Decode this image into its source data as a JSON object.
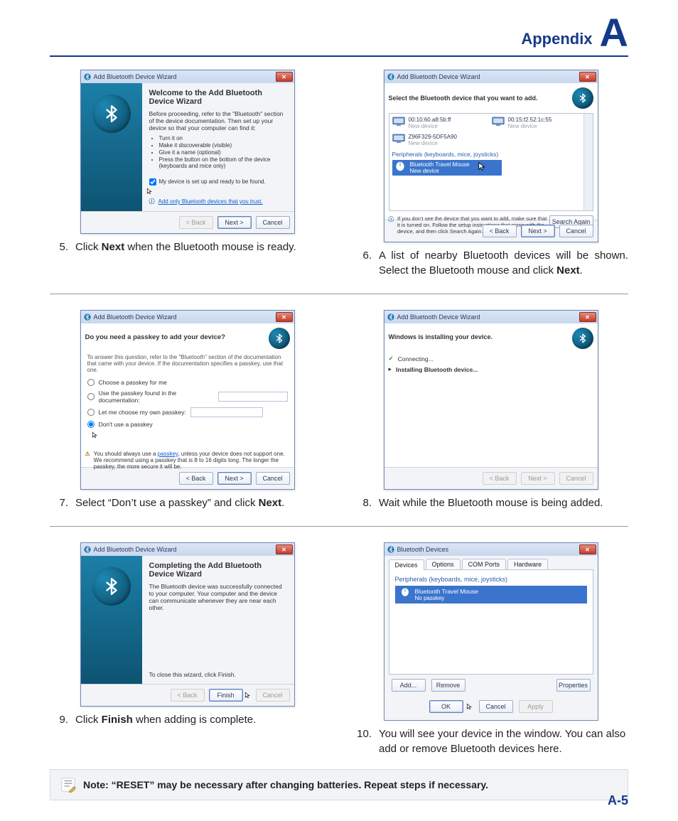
{
  "header": {
    "appendix": "Appendix",
    "bigA": "A"
  },
  "pageNumber": "A-5",
  "step5": {
    "winTitle": "Add Bluetooth Device Wizard",
    "title": "Welcome to the Add Bluetooth Device Wizard",
    "intro": "Before proceeding, refer to the \"Bluetooth\" section of the device documentation. Then set up your device so that your computer can find it:",
    "b1": "Turn it on",
    "b2": "Make it discoverable (visible)",
    "b3": "Give it a name (optional)",
    "b4": "Press the button on the bottom of the device (keyboards and mice only)",
    "check": "My device is set up and ready to be found.",
    "infoText": "Add only Bluetooth devices that you trust.",
    "back": "< Back",
    "next": "Next >",
    "cancel": "Cancel",
    "captionNum": "5.",
    "caption": "Click <b>Next</b> when the Bluetooth mouse is ready."
  },
  "step6": {
    "winTitle": "Add Bluetooth Device Wizard",
    "hint": "Select the Bluetooth device that you want to add.",
    "dev1": "00:10:60.a8:5b:ff",
    "dev1s": "New device",
    "dev2": "00:15:f2.52:1c:55",
    "dev2s": "New device",
    "dev3": "Z96F329-5DF5A90",
    "dev3s": "New device",
    "section": "Peripherals (keyboards, mice, joysticks)",
    "sel": "Bluetooth Travel Mouse",
    "sels": "New device",
    "footMsg": "If you don't see the device that you want to add, make sure that it is turned on. Follow the setup instructions that came with the device, and then click Search Again.",
    "search": "Search Again",
    "back": "< Back",
    "next": "Next >",
    "cancel": "Cancel",
    "captionNum": "6.",
    "caption": "A list of nearby Bluetooth devices will be shown. Select the Bluetooth mouse and click <b>Next</b>."
  },
  "step7": {
    "winTitle": "Add Bluetooth Device Wizard",
    "q": "Do you need a passkey to add your device?",
    "note": "To answer this question, refer to the \"Bluetooth\" section of the documentation that came with your device. If the documentation specifies a passkey, use that one.",
    "r1": "Choose a passkey for me",
    "r2": "Use the passkey found in the documentation:",
    "r3": "Let me choose my own passkey:",
    "r4": "Don't use a passkey",
    "warn": "You should always use a <a>passkey</a>, unless your device does not support one. We recommend using a passkey that is 8 to 16 digits long. The longer the passkey, the more secure it will be.",
    "back": "< Back",
    "next": "Next >",
    "cancel": "Cancel",
    "captionNum": "7.",
    "caption": "Select “Don’t use a passkey” and click <b>Next</b>."
  },
  "step8": {
    "winTitle": "Add Bluetooth Device Wizard",
    "hdr": "Windows is installing your device.",
    "p1": "Connecting...",
    "p2": "Installing Bluetooth device...",
    "back": "< Back",
    "next": "Next >",
    "cancel": "Cancel",
    "captionNum": "8.",
    "caption": "Wait while the Bluetooth mouse is being added."
  },
  "step9": {
    "winTitle": "Add Bluetooth Device Wizard",
    "title": "Completing the Add Bluetooth Device Wizard",
    "msg": "The Bluetooth device was successfully connected to your computer. Your computer and the device can communicate whenever they are near each other.",
    "close": "To close this wizard, click Finish.",
    "back": "< Back",
    "finish": "Finish",
    "cancel": "Cancel",
    "captionNum": "9.",
    "caption": "Click <b>Finish</b> when adding is complete."
  },
  "step10": {
    "winTitle": "Bluetooth Devices",
    "tabs": [
      "Devices",
      "Options",
      "COM Ports",
      "Hardware"
    ],
    "cat": "Peripherals (keyboards, mice, joysticks)",
    "sel": "Bluetooth Travel Mouse",
    "selSub": "No passkey",
    "add": "Add...",
    "remove": "Remove",
    "props": "Properties",
    "ok": "OK",
    "cancel": "Cancel",
    "apply": "Apply",
    "captionNum": "10.",
    "caption": "You will see your device in the window. You can also add or remove Bluetooth devices here."
  },
  "note": "Note: “RESET” may be necessary after changing batteries. Repeat steps if necessary."
}
